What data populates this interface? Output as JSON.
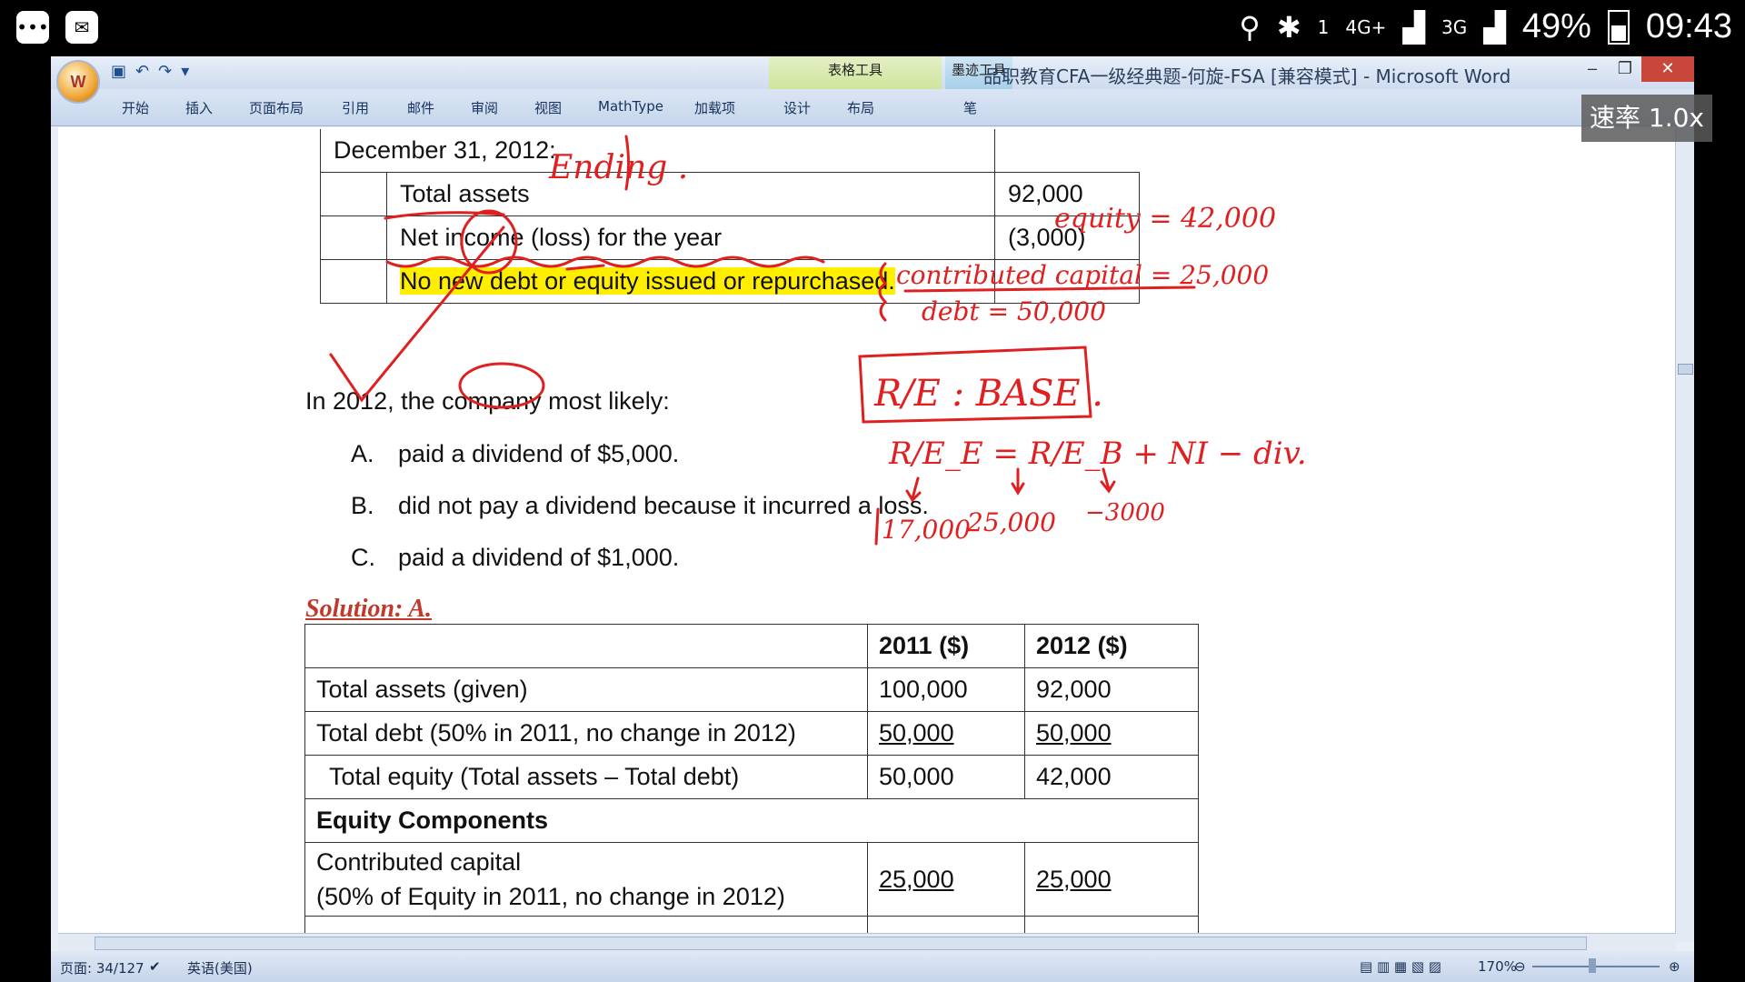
{
  "status_bar": {
    "battery": "49%",
    "time": "09:43",
    "net1": "4G+",
    "net2": "3G",
    "sim": "1"
  },
  "window": {
    "title": "品职教育CFA一级经典题-何旋-FSA [兼容模式] - Microsoft Word",
    "context_tabs": [
      "表格工具",
      "墨迹工具"
    ],
    "tabs": [
      "开始",
      "插入",
      "页面布局",
      "引用",
      "邮件",
      "审阅",
      "视图",
      "MathType",
      "加载项",
      "设计",
      "布局",
      "笔"
    ]
  },
  "speed_badge": "速率 1.0x",
  "question_table": {
    "heading": "December 31, 2012:",
    "rows": [
      {
        "label": "Total assets",
        "value": "92,000"
      },
      {
        "label": "Net income (loss) for the year",
        "value": "(3,000)"
      },
      {
        "label": "No new debt or equity issued or repurchased.",
        "value": ""
      }
    ]
  },
  "question": "In 2012, the company most likely:",
  "options": [
    {
      "letter": "A.",
      "text": "paid a dividend of $5,000."
    },
    {
      "letter": "B.",
      "text": "did not pay a dividend because it incurred a loss."
    },
    {
      "letter": "C.",
      "text": "paid a dividend of $1,000."
    }
  ],
  "solution_label": "Solution: A.",
  "solution_table": {
    "headers": [
      "",
      "2011 ($)",
      "2012 ($)"
    ],
    "rows": [
      [
        "Total assets (given)",
        "100,000",
        "92,000"
      ],
      [
        "Total debt (50% in 2011, no change in 2012)",
        "50,000",
        "50,000"
      ],
      [
        "Total equity (Total assets – Total debt)",
        "50,000",
        "42,000"
      ],
      [
        "Equity Components",
        "",
        ""
      ],
      [
        "Contributed capital",
        "25,000",
        "25,000"
      ],
      [
        "(50% of Equity in 2011, no change in 2012)",
        "",
        ""
      ]
    ]
  },
  "handwriting": {
    "ending": "Ending .",
    "equity": "equity = 42,000",
    "contributed": "contributed capital = 25,000",
    "debt": "debt = 50,000",
    "re_base": "R/E : BASE .",
    "formula": "R/E_E = R/E_B + NI − div.",
    "re_end": "17,000",
    "re_begin": "25,000",
    "ni": "−3000"
  },
  "status_line": {
    "page": "页面: 34/127",
    "language": "英语(美国)",
    "zoom": "170%"
  },
  "colors": {
    "ink": "#e02020",
    "highlight": "#ffee00",
    "solution": "#c0392b"
  }
}
